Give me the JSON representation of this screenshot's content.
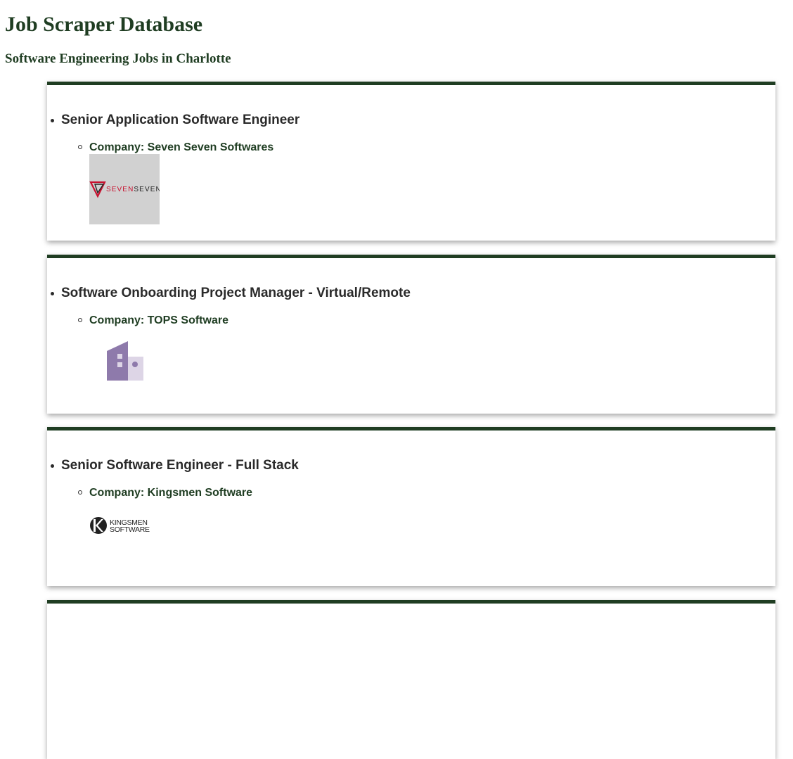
{
  "page": {
    "title": "Job Scraper Database",
    "subtitle": "Software Engineering Jobs in Charlotte"
  },
  "jobs": [
    {
      "title": "Senior Application Software Engineer",
      "company": "Company: Seven Seven Softwares",
      "logo_icon": "seven-seven-logo",
      "logo_text": "SEVENSEVEN"
    },
    {
      "title": "Software Onboarding Project Manager - Virtual/Remote",
      "company": "Company: TOPS Software",
      "logo_icon": "building-placeholder-icon"
    },
    {
      "title": "Senior Software Engineer - Full Stack",
      "company": "Company: Kingsmen Software",
      "logo_icon": "kingsmen-logo",
      "logo_text": [
        "KINGSMEN",
        "SOFTWARE"
      ]
    }
  ],
  "colors": {
    "heading": "#1f3d22",
    "card_border": "#1f3d22",
    "logo_bg": "#d1d1d1",
    "seven_red": "#c8102e",
    "building_purple": "#8e7aab",
    "building_light": "#ddd5e6"
  }
}
